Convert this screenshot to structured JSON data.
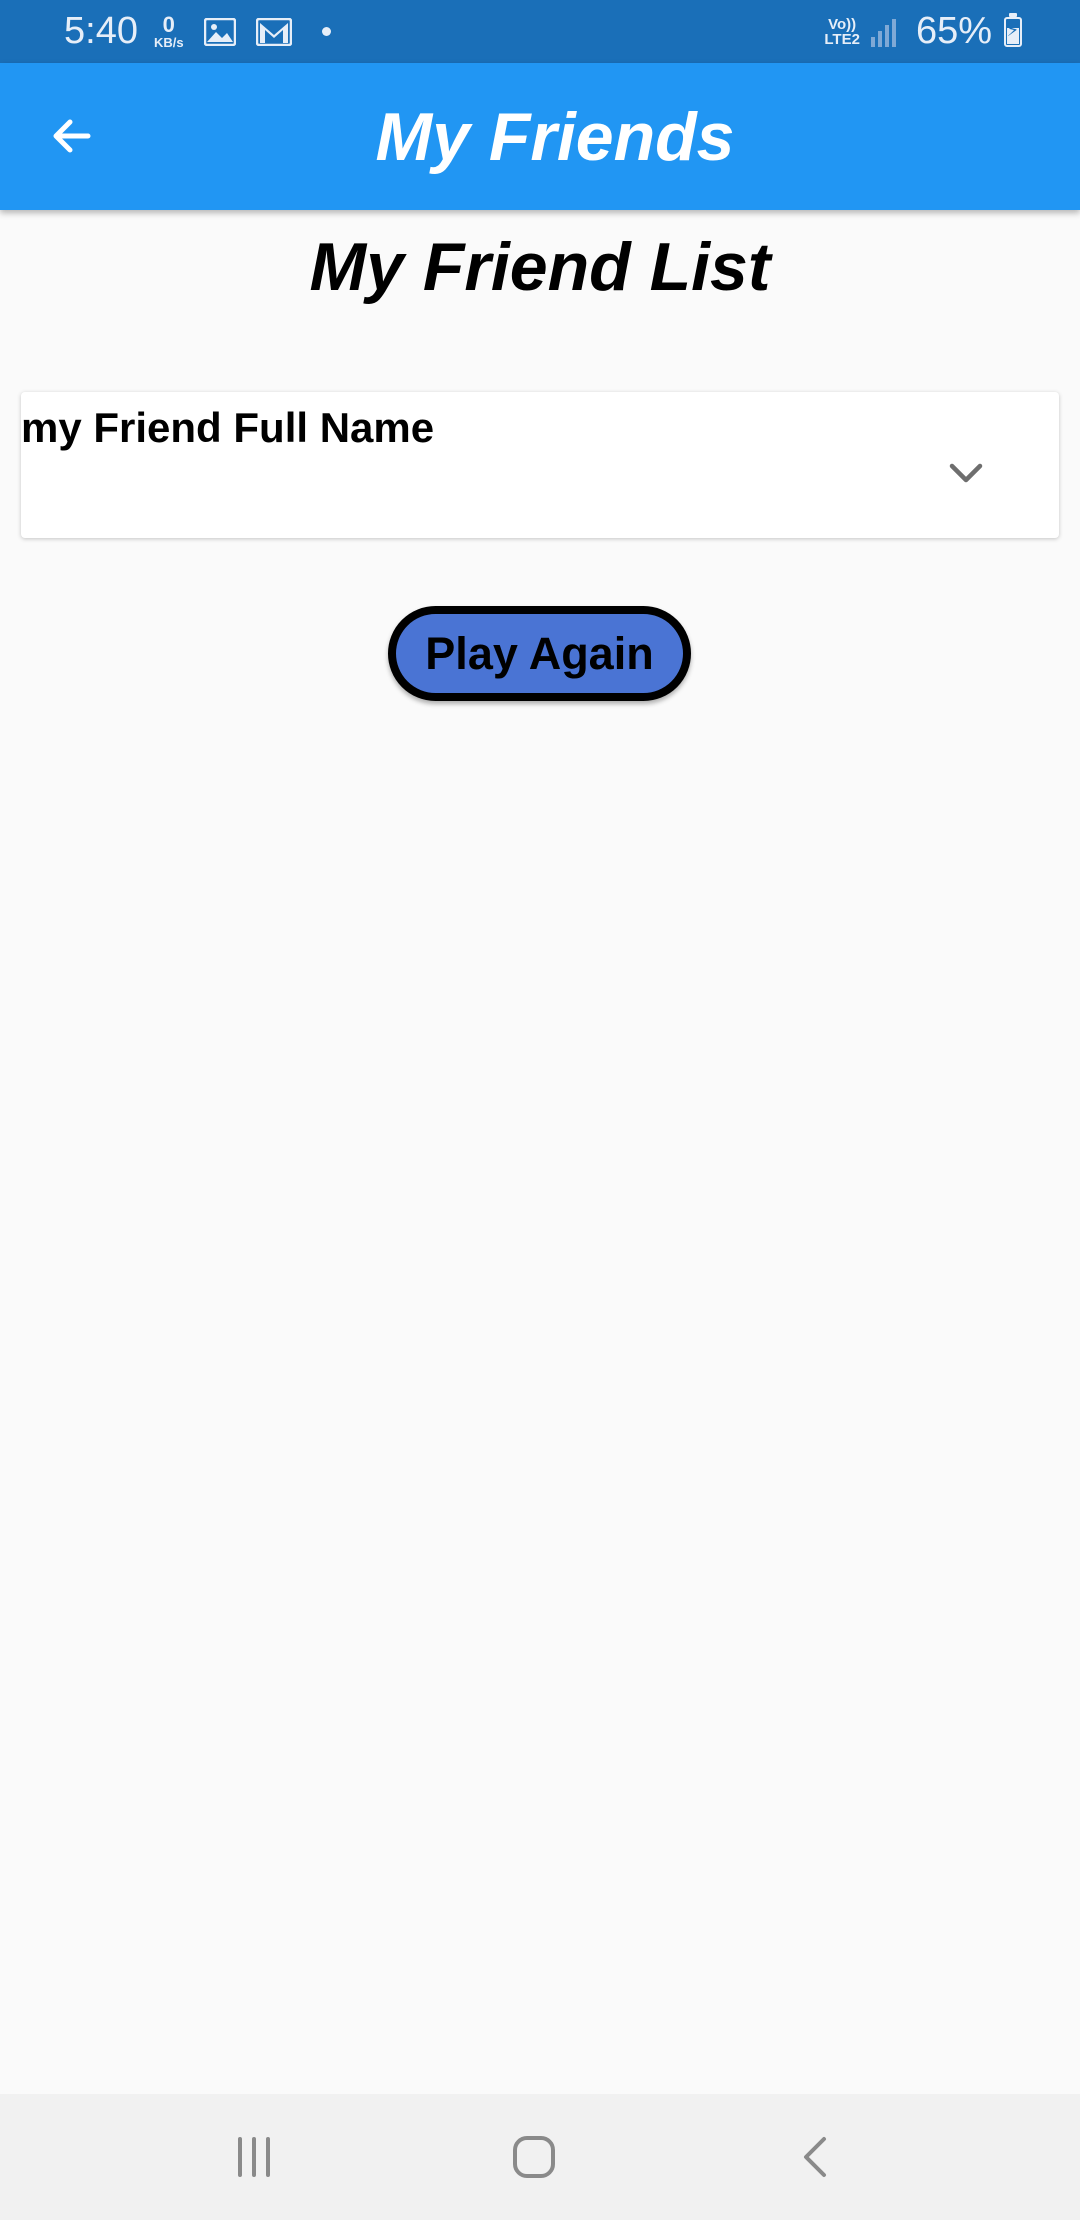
{
  "status_bar": {
    "time": "5:40",
    "net_speed_value": "0",
    "net_speed_unit": "KB/s",
    "icons": [
      "gallery-icon",
      "mail-icon",
      "dot-icon"
    ],
    "lte_top": "Vo))",
    "lte_bottom": "LTE2",
    "battery_percent": "65%"
  },
  "app_bar": {
    "title": "My Friends",
    "back_icon": "arrow-left-icon",
    "color": "#2196f3"
  },
  "content": {
    "heading": "My Friend List",
    "dropdown": {
      "label": "my Friend Full Name",
      "icon": "chevron-down-icon"
    },
    "play_button": {
      "label": "Play Again",
      "color": "#4a74d4"
    }
  },
  "nav_bar": {
    "items": [
      "recent-apps-icon",
      "home-icon",
      "back-icon"
    ]
  }
}
